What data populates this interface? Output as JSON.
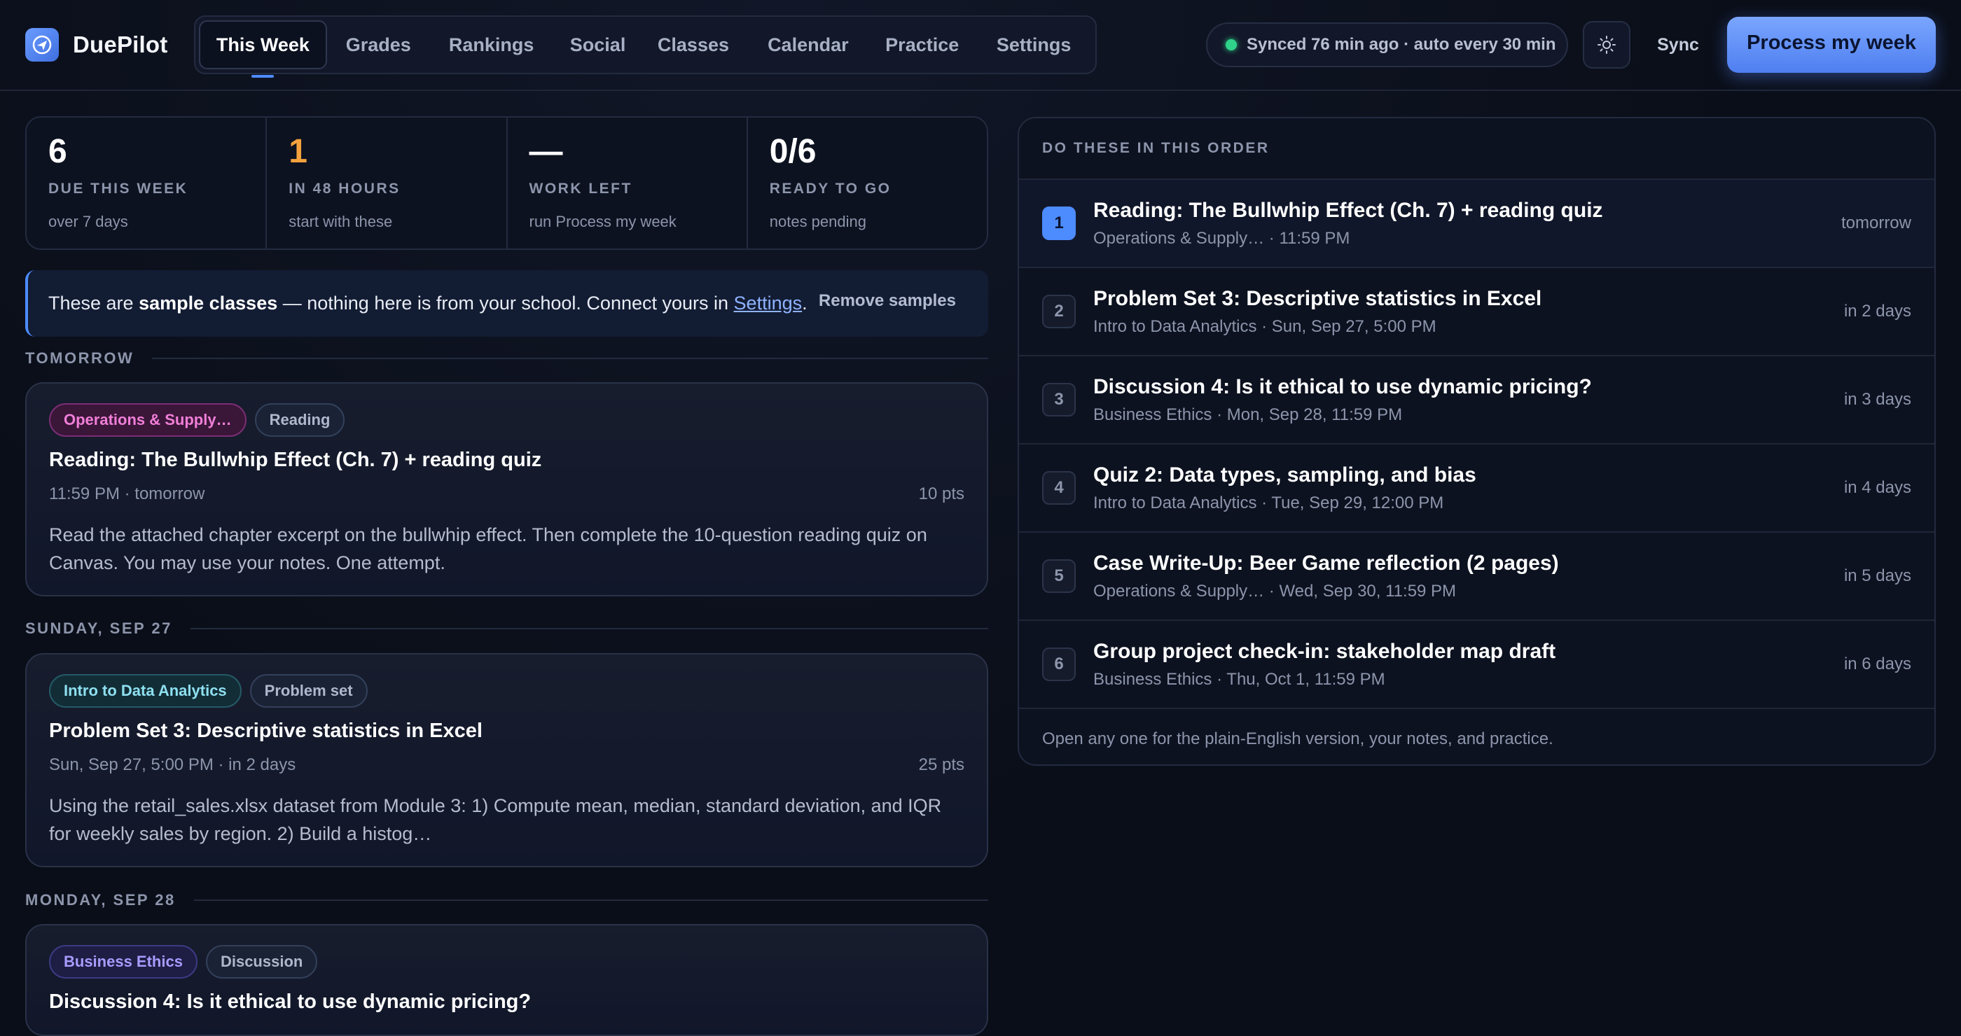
{
  "app": {
    "name": "DuePilot",
    "logo_icon": "paper-plane-icon"
  },
  "nav": {
    "tabs": [
      {
        "label": "This Week",
        "active": true
      },
      {
        "label": "Grades"
      },
      {
        "label": "Rankings"
      },
      {
        "label": "Social"
      },
      {
        "label": "Classes"
      },
      {
        "label": "Calendar"
      },
      {
        "label": "Practice"
      },
      {
        "label": "Settings"
      }
    ]
  },
  "header": {
    "sync_status": "Synced 76 min ago · auto every 30 min",
    "theme_icon": "sun-icon",
    "sync_label": "Sync",
    "process_label": "Process my week"
  },
  "stats": [
    {
      "value": "6",
      "label": "DUE THIS WEEK",
      "sub": "over 7 days"
    },
    {
      "value": "1",
      "label": "IN 48 HOURS",
      "sub": "start with these"
    },
    {
      "value": "—",
      "label": "WORK LEFT",
      "sub": "run Process my week"
    },
    {
      "value": "0/6",
      "label": "READY TO GO",
      "sub": "notes pending"
    }
  ],
  "banner": {
    "prefix": "These are ",
    "bold": "sample classes",
    "middle": " — nothing here is from your school. Connect yours in ",
    "link": "Settings",
    "suffix": ".",
    "remove_label": "Remove samples"
  },
  "days": [
    {
      "heading": "TOMORROW",
      "card": {
        "course": "Operations & Supply…",
        "type": "Reading",
        "title": "Reading: The Bullwhip Effect (Ch. 7) + reading quiz",
        "when": "11:59 PM · tomorrow",
        "points": "10 pts",
        "desc": "Read the attached chapter excerpt on the bullwhip effect. Then complete the 10-question reading quiz on Canvas. You may use your notes. One attempt."
      }
    },
    {
      "heading": "SUNDAY, SEP 27",
      "card": {
        "course": "Intro to Data Analytics",
        "type": "Problem set",
        "title": "Problem Set 3: Descriptive statistics in Excel",
        "when": "Sun, Sep 27, 5:00 PM · in 2 days",
        "points": "25 pts",
        "desc": "Using the retail_sales.xlsx dataset from Module 3: 1) Compute mean, median, standard deviation, and IQR for weekly sales by region. 2) Build a histog…"
      }
    },
    {
      "heading": "MONDAY, SEP 28",
      "card": {
        "course": "Business Ethics",
        "type": "Discussion",
        "title": "Discussion 4: Is it ethical to use dynamic pricing?"
      }
    }
  ],
  "order": {
    "heading": "DO THESE IN THIS ORDER",
    "items": [
      {
        "num": "1",
        "title": "Reading: The Bullwhip Effect (Ch. 7) + reading quiz",
        "sub": "Operations & Supply… · 11:59 PM",
        "when": "tomorrow"
      },
      {
        "num": "2",
        "title": "Problem Set 3: Descriptive statistics in Excel",
        "sub": "Intro to Data Analytics · Sun, Sep 27, 5:00 PM",
        "when": "in 2 days"
      },
      {
        "num": "3",
        "title": "Discussion 4: Is it ethical to use dynamic pricing?",
        "sub": "Business Ethics · Mon, Sep 28, 11:59 PM",
        "when": "in 3 days"
      },
      {
        "num": "4",
        "title": "Quiz 2: Data types, sampling, and bias",
        "sub": "Intro to Data Analytics · Tue, Sep 29, 12:00 PM",
        "when": "in 4 days"
      },
      {
        "num": "5",
        "title": "Case Write-Up: Beer Game reflection (2 pages)",
        "sub": "Operations & Supply… · Wed, Sep 30, 11:59 PM",
        "when": "in 5 days"
      },
      {
        "num": "6",
        "title": "Group project check-in: stakeholder map draft",
        "sub": "Business Ethics · Thu, Oct 1, 11:59 PM",
        "when": "in 6 days"
      }
    ],
    "footer": "Open any one for the plain-English version, your notes, and practice."
  },
  "colors": {
    "accent": "#4d8cff",
    "urgent": "#f5a23d",
    "synced": "#2fd48a",
    "chip_ops": "#f07fd8",
    "chip_data": "#8ee0f0",
    "chip_ethics": "#a89cff"
  }
}
